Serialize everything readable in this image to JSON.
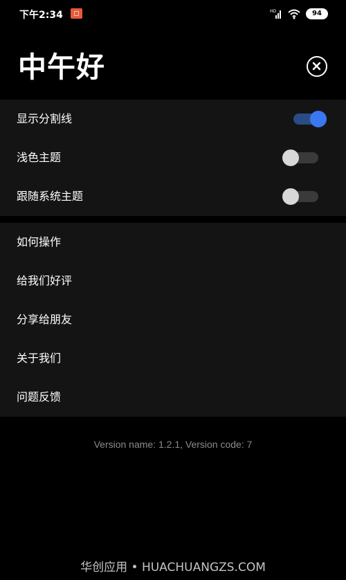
{
  "status_bar": {
    "time": "下午2:34",
    "app_icon": "notification-app-icon",
    "network_label": "HD",
    "battery": "94"
  },
  "header": {
    "title": "中午好",
    "close_icon": "close-circle-icon"
  },
  "settings": {
    "items": [
      {
        "label": "显示分割线",
        "enabled": true
      },
      {
        "label": "浅色主题",
        "enabled": false
      },
      {
        "label": "跟随系统主题",
        "enabled": false
      }
    ]
  },
  "menu": {
    "items": [
      {
        "label": "如何操作"
      },
      {
        "label": "给我们好评"
      },
      {
        "label": "分享给朋友"
      },
      {
        "label": "关于我们"
      },
      {
        "label": "问题反馈"
      }
    ]
  },
  "version": "Version name: 1.2.1, Version code: 7",
  "watermark": "华创应用 • HUACHUANGZS.COM",
  "colors": {
    "background": "#000000",
    "section_background": "#141414",
    "toggle_on_knob": "#3a78f2",
    "toggle_on_track": "#2a4c84",
    "toggle_off_knob": "#d8d8d8",
    "toggle_off_track": "#3a3a3a",
    "version_text": "#8b8b8b"
  }
}
